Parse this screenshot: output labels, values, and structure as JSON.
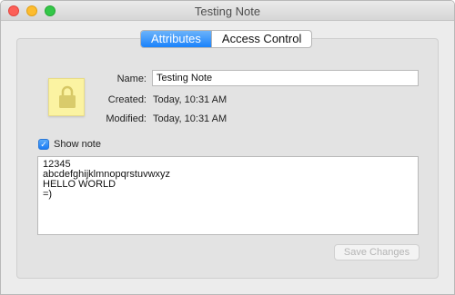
{
  "window": {
    "title": "Testing Note"
  },
  "tabs": [
    {
      "label": "Attributes",
      "active": true
    },
    {
      "label": "Access Control",
      "active": false
    }
  ],
  "attributes": {
    "name_label": "Name:",
    "name_value": "Testing Note",
    "created_label": "Created:",
    "created_value": "Today, 10:31 AM",
    "modified_label": "Modified:",
    "modified_value": "Today, 10:31 AM"
  },
  "show_note": {
    "label": "Show note",
    "checked": true
  },
  "note_content": "12345\nabcdefghijklmnopqrstuvwxyz\nHELLO WORLD\n=)",
  "save_button": {
    "label": "Save Changes",
    "enabled": false
  },
  "icons": {
    "note": "note-lock-icon",
    "checkbox": "checkmark-icon"
  },
  "colors": {
    "accent": "#1a82fb",
    "note_yellow": "#fbf3a2"
  }
}
